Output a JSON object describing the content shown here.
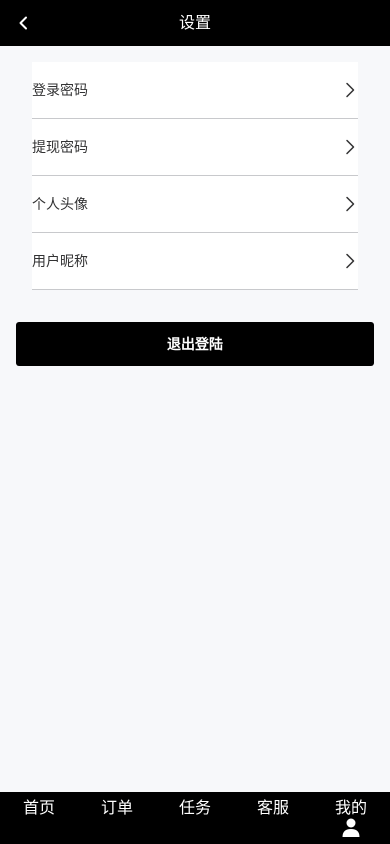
{
  "header": {
    "title": "设置"
  },
  "settings": {
    "items": [
      {
        "label": "登录密码"
      },
      {
        "label": "提现密码"
      },
      {
        "label": "个人头像"
      },
      {
        "label": "用户昵称"
      }
    ]
  },
  "logout": {
    "label": "退出登陆"
  },
  "tabbar": {
    "items": [
      {
        "label": "首页"
      },
      {
        "label": "订单"
      },
      {
        "label": "任务"
      },
      {
        "label": "客服"
      },
      {
        "label": "我的",
        "icon": "person-icon"
      }
    ]
  }
}
